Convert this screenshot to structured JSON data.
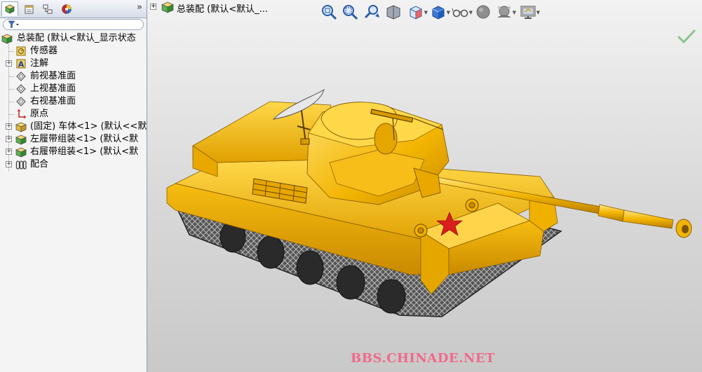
{
  "feature_manager": {
    "tabs": [
      {
        "icon": "feature-manager-tab-icon",
        "active": true
      },
      {
        "icon": "property-manager-tab-icon",
        "active": false
      },
      {
        "icon": "configuration-manager-tab-icon",
        "active": false
      },
      {
        "icon": "display-manager-tab-icon",
        "active": false
      }
    ],
    "expand_glyph": "»",
    "filter_icon": "filter-icon",
    "tree": [
      {
        "label": "总装配 (默认<默认_显示状态",
        "icon": "assembly-icon",
        "expander": ""
      },
      {
        "label": "传感器",
        "icon": "sensor-icon",
        "expander": ""
      },
      {
        "label": "注解",
        "icon": "annotation-icon",
        "expander": "+"
      },
      {
        "label": "前视基准面",
        "icon": "plane-icon",
        "expander": ""
      },
      {
        "label": "上视基准面",
        "icon": "plane-icon",
        "expander": ""
      },
      {
        "label": "右视基准面",
        "icon": "plane-icon",
        "expander": ""
      },
      {
        "label": "原点",
        "icon": "origin-icon",
        "expander": ""
      },
      {
        "label": "(固定) 车体<1> (默认<<默",
        "icon": "subassembly-icon",
        "expander": "+"
      },
      {
        "label": "左履带组装<1> (默认<默",
        "icon": "subassembly-icon",
        "expander": "+"
      },
      {
        "label": "右履带组装<1> (默认<默",
        "icon": "subassembly-icon",
        "expander": "+"
      },
      {
        "label": "配合",
        "icon": "mates-icon",
        "expander": "+"
      }
    ]
  },
  "graphics": {
    "flyout_tree": {
      "expander": "+",
      "icon": "assembly-icon",
      "label": "总装配 (默认<默认_..."
    },
    "heads_up_toolbar": [
      {
        "icon": "zoom-to-fit-icon",
        "dropdown": false
      },
      {
        "icon": "zoom-to-area-icon",
        "dropdown": false
      },
      {
        "icon": "previous-view-icon",
        "dropdown": false
      },
      {
        "icon": "section-view-icon",
        "dropdown": false
      },
      {
        "icon": "view-orientation-icon",
        "dropdown": true
      },
      {
        "icon": "display-style-icon",
        "dropdown": true
      },
      {
        "icon": "hide-show-items-icon",
        "dropdown": true
      },
      {
        "icon": "edit-appearance-icon",
        "dropdown": false
      },
      {
        "icon": "apply-scene-icon",
        "dropdown": true
      },
      {
        "icon": "view-settings-icon",
        "dropdown": true
      }
    ],
    "confirm_icon": "confirm-check-icon",
    "model": "tank-3d-model",
    "watermark": "BBS.CHINADE.NET",
    "colors": {
      "model_body": "#f2b400",
      "model_highlight": "#ffd84a",
      "model_shadow": "#c98a00",
      "track": "#3a3a3a",
      "star": "#d81e1e",
      "watermark": "#f06a8a"
    }
  }
}
